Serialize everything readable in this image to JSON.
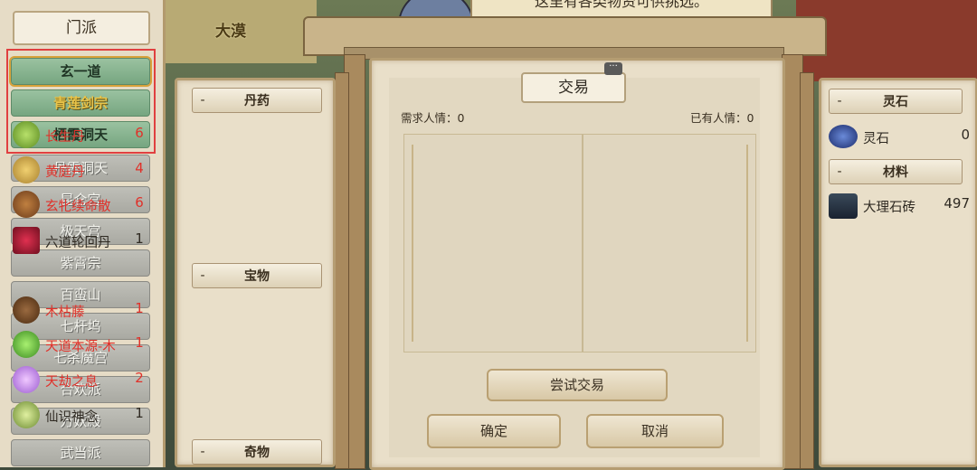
{
  "scene": {
    "region": "大漠",
    "npc_speech": "这里有各类物资可供挑选。"
  },
  "sects": {
    "title": "门派",
    "list": [
      "玄一道",
      "青莲剑宗",
      "栖霞洞天",
      "丹霞洞天",
      "昆仑宫",
      "极天宫",
      "紫霄宗",
      "百蛮山",
      "七杆坞",
      "七杀魔宫",
      "合欢派",
      "万妖殿",
      "武当派"
    ]
  },
  "items": {
    "sections": {
      "pills": "丹药",
      "treasures": "宝物",
      "curios": "奇物"
    },
    "pills": [
      {
        "name": "长生丹",
        "count": "6"
      },
      {
        "name": "黄庭丹",
        "count": "4"
      },
      {
        "name": "玄牝续命散",
        "count": "6"
      },
      {
        "name": "六道轮回丹",
        "count": "1"
      }
    ],
    "treasures": [
      {
        "name": "木枯藤",
        "count": "1"
      },
      {
        "name": "天道本源-木",
        "count": "1"
      },
      {
        "name": "天劫之息",
        "count": "2"
      },
      {
        "name": "仙识神念",
        "count": "1"
      }
    ]
  },
  "trade": {
    "title": "交易",
    "need_label": "需求人情：0",
    "have_label": "已有人情：0",
    "try_button": "尝试交易",
    "ok_button": "确定",
    "cancel_button": "取消",
    "chat_glyph": "···"
  },
  "resources": {
    "sections": {
      "spirit_stone": "灵石",
      "materials": "材料"
    },
    "spirit_stone": {
      "name": "灵石",
      "count": "0"
    },
    "marble": {
      "name": "大理石砖",
      "count": "497"
    }
  },
  "colors": {
    "accent_red": "#e0312a",
    "gold": "#e9c44a",
    "selected_green": "#8bb894"
  }
}
